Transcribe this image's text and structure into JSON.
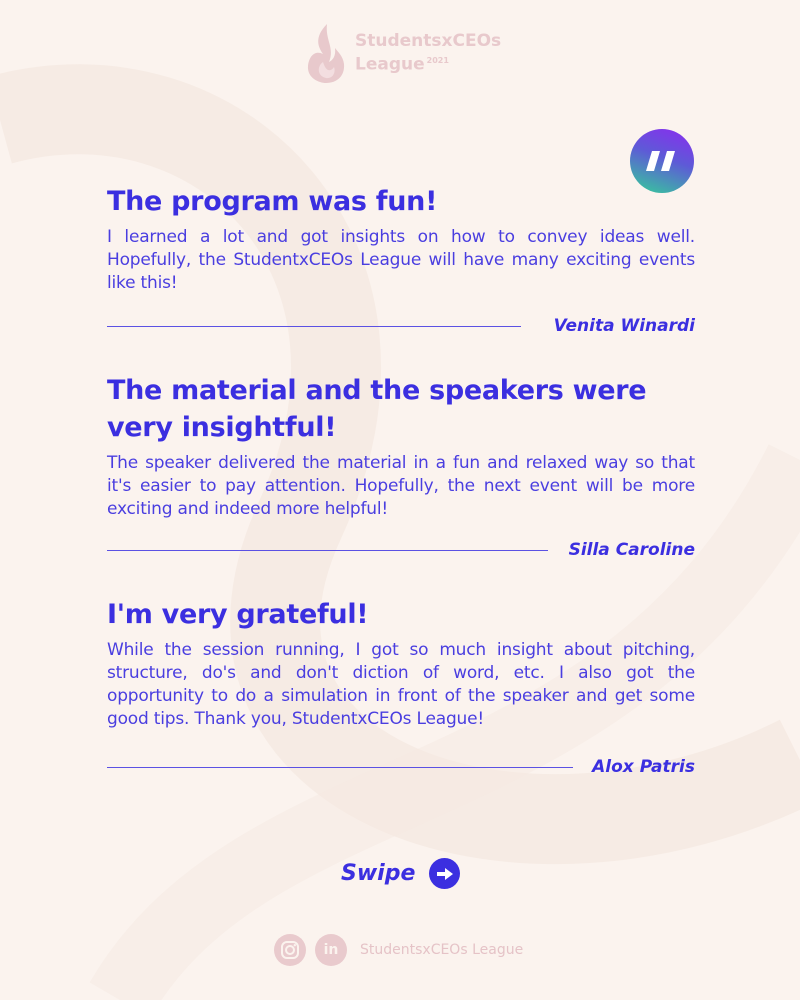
{
  "brand": {
    "name": "StudentsxCEOs",
    "name_line2": "League",
    "year": "2021"
  },
  "testimonials": [
    {
      "title": "The program was fun!",
      "body": "I learned a lot and got insights on how to convey ideas well. Hopefully, the StudentxCEOs League will have many exciting events like this!",
      "author": "Venita Winardi"
    },
    {
      "title": "The material and the speakers were very insightful!",
      "body": "The speaker delivered the material in a fun and relaxed way so that it's easier to pay attention. Hopefully, the next event will be more exciting and indeed more helpful!",
      "author": "Silla Caroline"
    },
    {
      "title": "I'm very grateful!",
      "body": "While the session running, I got so much insight about pitching, structure, do's and don't diction of word, etc. I also got the opportunity to do a simulation in front of the speaker and get some good tips. Thank you, StudentxCEOs League!",
      "author": "Alox Patris"
    }
  ],
  "swipe": {
    "label": "Swipe",
    "icon": "arrow-right-icon"
  },
  "social": {
    "icons": [
      "instagram-icon",
      "linkedin-icon"
    ],
    "linkedin_glyph": "in",
    "label": "StudentsxCEOs League"
  },
  "colors": {
    "background": "#fbf3ee",
    "accent": "#3b2fe0",
    "logo": "#e8c9cc",
    "badge_gradient": [
      "#8b2bf0",
      "#34cf98"
    ]
  }
}
